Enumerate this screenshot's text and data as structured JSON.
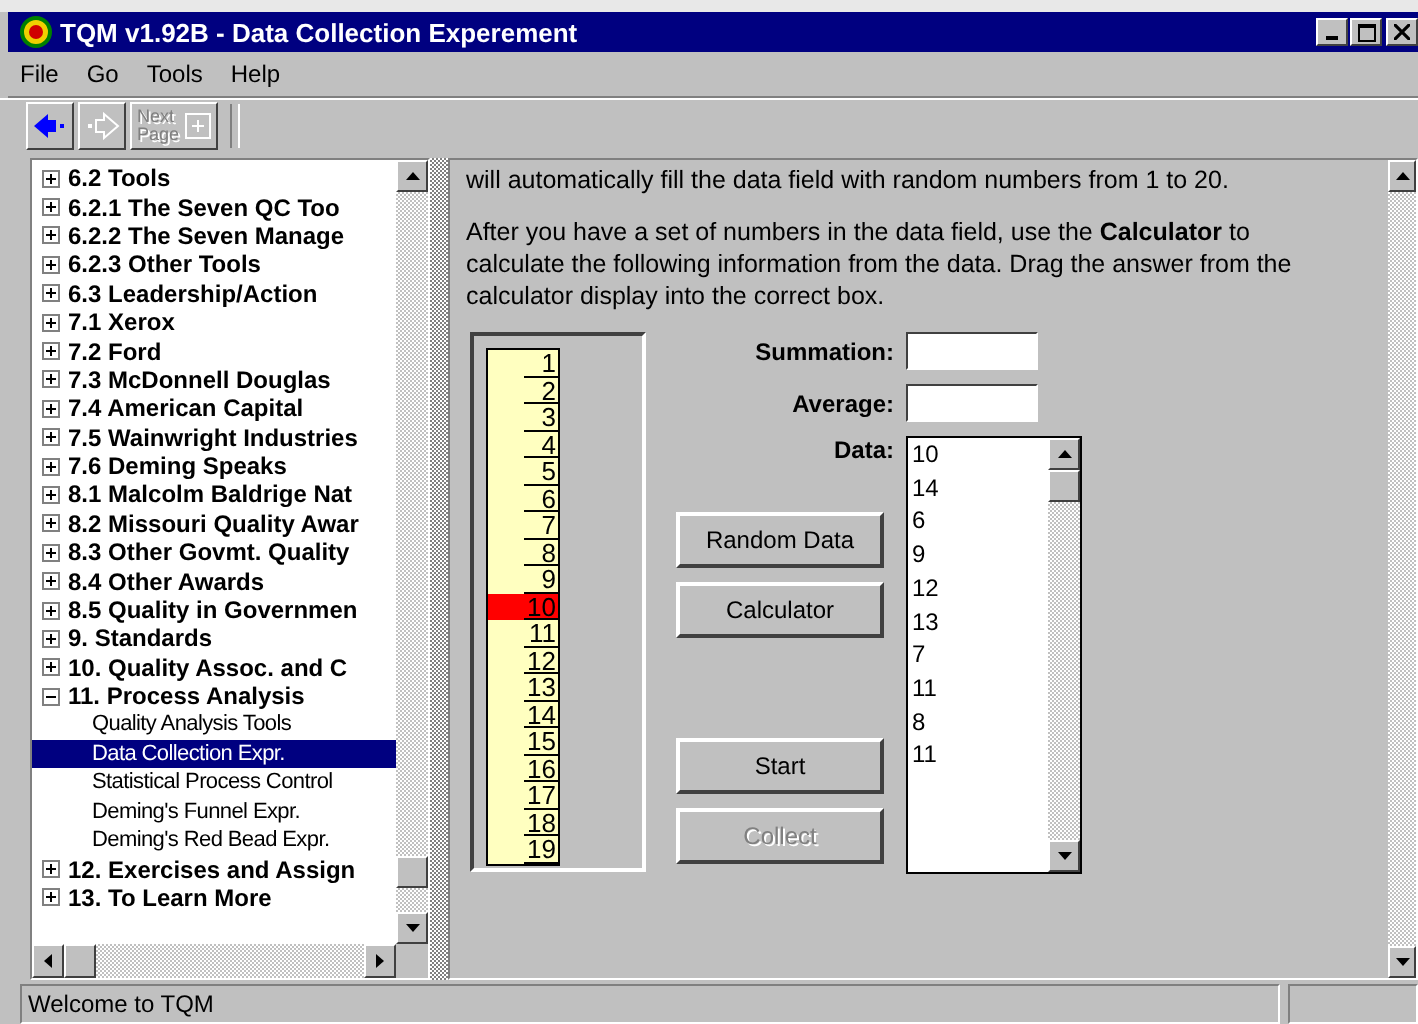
{
  "window": {
    "title": "TQM v1.92B - Data Collection Experement"
  },
  "menu": [
    "File",
    "Go",
    "Tools",
    "Help"
  ],
  "toolbar": [
    {
      "kind": "back",
      "disabled": false
    },
    {
      "kind": "forward",
      "disabled": true
    },
    {
      "kind": "next",
      "label": "Next Page",
      "disabled": true
    }
  ],
  "tree": [
    {
      "label": "6.2 Tools",
      "expanded": false
    },
    {
      "label": "6.2.1 The Seven QC Too",
      "expanded": false
    },
    {
      "label": "6.2.2 The Seven Manage",
      "expanded": false
    },
    {
      "label": "6.2.3 Other Tools",
      "expanded": false
    },
    {
      "label": "6.3 Leadership/Action",
      "expanded": false
    },
    {
      "label": "7.1 Xerox",
      "expanded": false
    },
    {
      "label": "7.2 Ford",
      "expanded": false
    },
    {
      "label": "7.3 McDonnell Douglas",
      "expanded": false
    },
    {
      "label": "7.4 American Capital",
      "expanded": false
    },
    {
      "label": "7.5 Wainwright Industries",
      "expanded": false
    },
    {
      "label": "7.6 Deming Speaks",
      "expanded": false
    },
    {
      "label": "8.1 Malcolm Baldrige Nat",
      "expanded": false
    },
    {
      "label": "8.2 Missouri Quality Awar",
      "expanded": false
    },
    {
      "label": "8.3 Other Govmt. Quality",
      "expanded": false
    },
    {
      "label": "8.4 Other Awards",
      "expanded": false
    },
    {
      "label": "8.5 Quality in Governmen",
      "expanded": false
    },
    {
      "label": "9. Standards",
      "expanded": false
    },
    {
      "label": "10. Quality Assoc. and C",
      "expanded": false
    },
    {
      "label": "11. Process Analysis",
      "expanded": true,
      "children": [
        {
          "label": "Quality Analysis Tools",
          "selected": false
        },
        {
          "label": "Data Collection Expr.",
          "selected": true
        },
        {
          "label": "Statistical Process Control",
          "selected": false
        },
        {
          "label": "Deming's Funnel Expr.",
          "selected": false
        },
        {
          "label": "Deming's Red Bead Expr.",
          "selected": false
        }
      ]
    },
    {
      "label": "12. Exercises and Assign",
      "expanded": false
    },
    {
      "label": "13. To Learn More",
      "expanded": false
    }
  ],
  "content": {
    "paragraphs": [
      "will automatically fill the data field with random numbers from 1 to 20.",
      "After you have a set of numbers in the data field, use the **Calculator** to calculate the following information from the data. Drag the answer from the calculator display into the correct box."
    ],
    "tape": [
      {
        "label": "1",
        "highlighted": false
      },
      {
        "label": "2",
        "highlighted": false
      },
      {
        "label": "3",
        "highlighted": false
      },
      {
        "label": "4",
        "highlighted": false
      },
      {
        "label": "5",
        "highlighted": false
      },
      {
        "label": "6",
        "highlighted": false
      },
      {
        "label": "7",
        "highlighted": false
      },
      {
        "label": "8",
        "highlighted": false
      },
      {
        "label": "9",
        "highlighted": false
      },
      {
        "label": "10",
        "highlighted": true
      },
      {
        "label": "11",
        "highlighted": false
      },
      {
        "label": "12",
        "highlighted": false
      },
      {
        "label": "13",
        "highlighted": false
      },
      {
        "label": "14",
        "highlighted": false
      },
      {
        "label": "15",
        "highlighted": false
      },
      {
        "label": "16",
        "highlighted": false
      },
      {
        "label": "17",
        "highlighted": false
      },
      {
        "label": "18",
        "highlighted": false
      },
      {
        "label": "19",
        "highlighted": false
      }
    ],
    "fields": [
      {
        "label": "Summation:"
      },
      {
        "label": "Average:"
      }
    ],
    "data_label": "Data:",
    "data": [
      "10",
      "14",
      "6",
      "9",
      "12",
      "13",
      "7",
      "11",
      "8",
      "11"
    ],
    "buttons": [
      {
        "label": "Random Data",
        "disabled": false
      },
      {
        "label": "Calculator",
        "disabled": false
      },
      {
        "label": "Start",
        "disabled": false
      },
      {
        "label": "Collect",
        "disabled": true
      }
    ]
  },
  "status_bar": {
    "text": "Welcome to TQM"
  }
}
